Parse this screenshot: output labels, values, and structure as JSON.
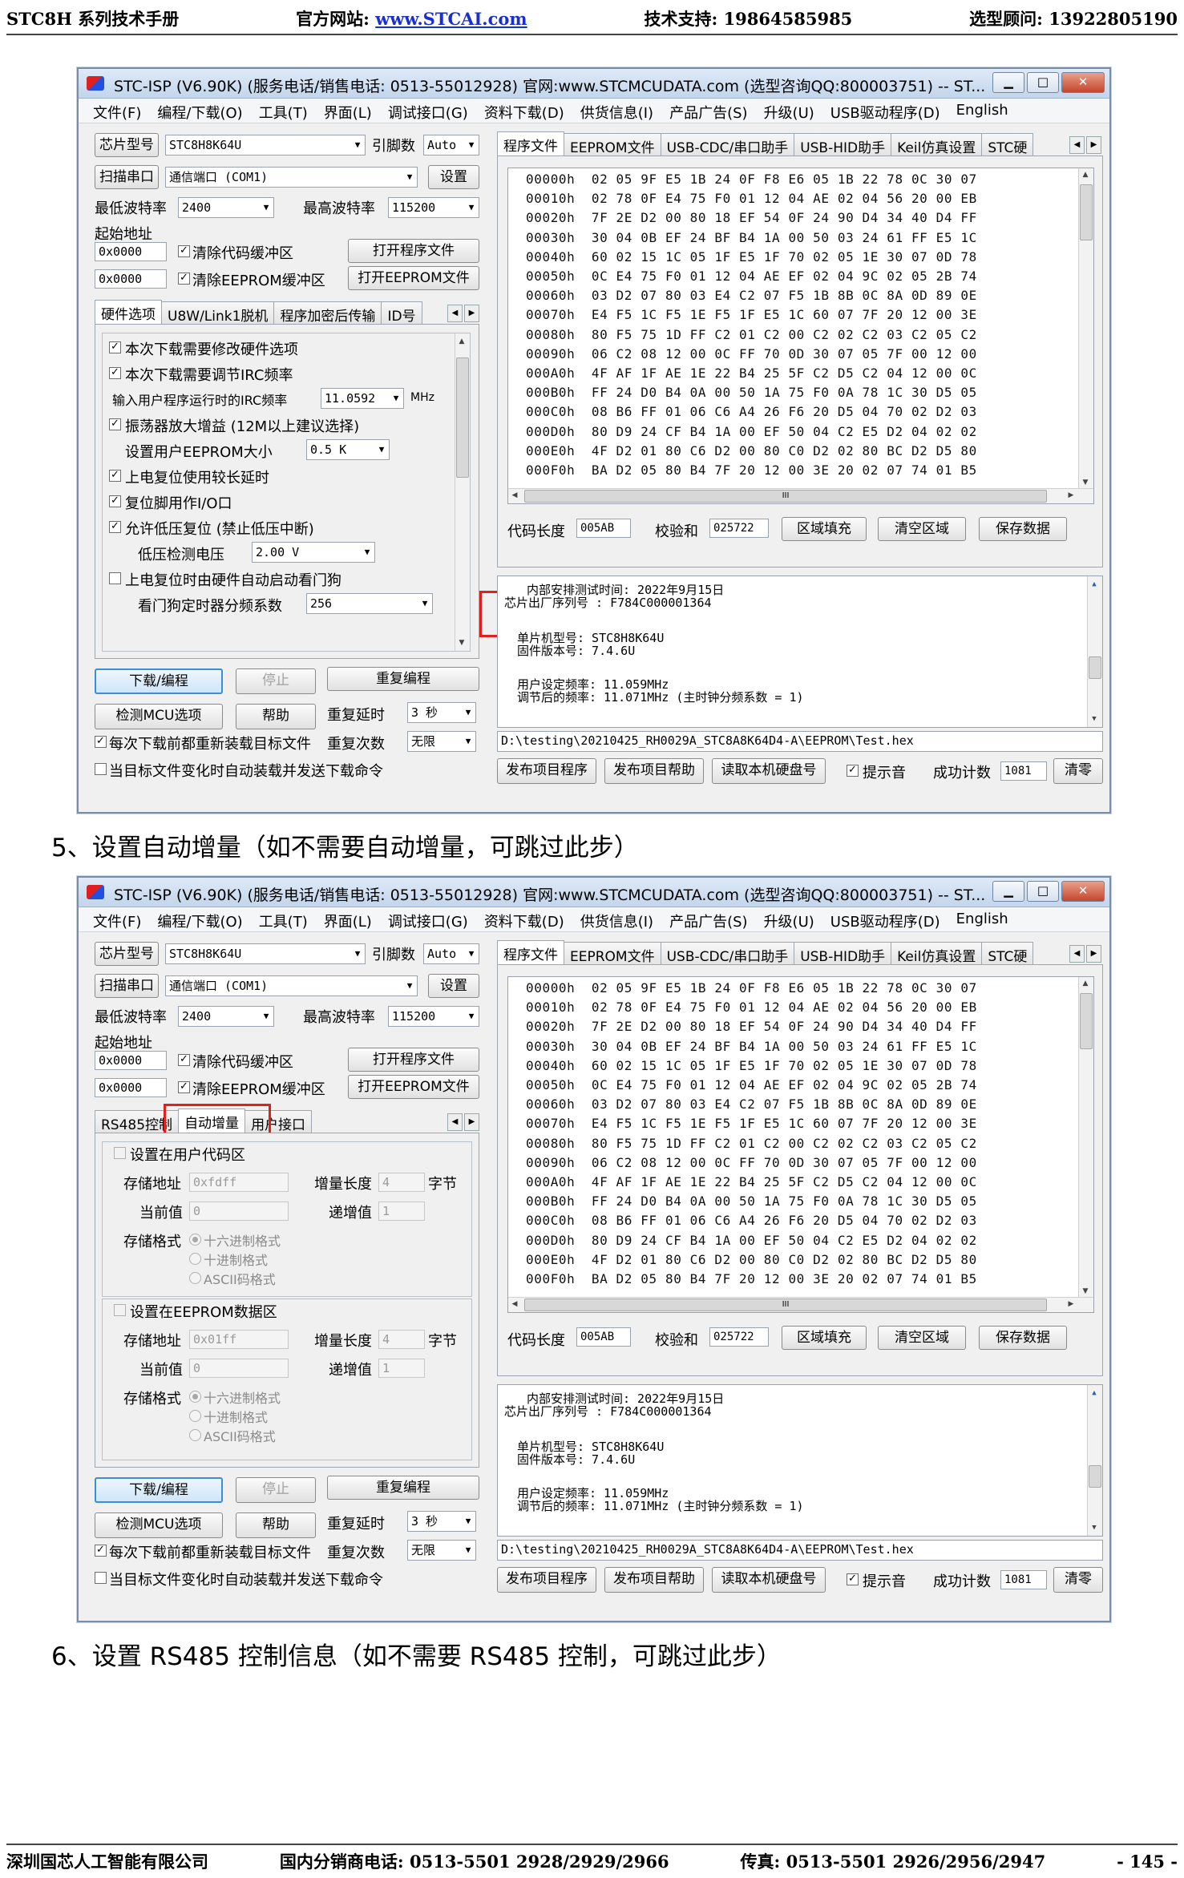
{
  "header": {
    "left": "STC8H 系列技术手册",
    "site_label": "官方网站: ",
    "site_link": "www.STCAI.com",
    "support": "技术支持: 19864585985",
    "sales": "选型顾问: 13922805190"
  },
  "footer": {
    "company": "深圳国芯人工智能有限公司",
    "dist_phone": "国内分销商电话: 0513-5501 2928/2929/2966",
    "fax": "传真: 0513-5501 2926/2956/2947",
    "page": "- 145 -"
  },
  "steps": {
    "step5": "5、设置自动增量（如不需要自动增量，可跳过此步）",
    "step6": "6、设置 RS485 控制信息（如不需要 RS485 控制，可跳过此步）"
  },
  "window": {
    "title": "STC-ISP (V6.90K) (服务电话/销售电话: 0513-55012928) 官网:www.STCMCUDATA.com  (选型咨询QQ:800003751) -- ST...",
    "caption": {
      "min": "▁",
      "max": "□",
      "close": "✕"
    },
    "menu": [
      "文件(F)",
      "编程/下载(O)",
      "工具(T)",
      "界面(L)",
      "调试接口(G)",
      "资料下载(D)",
      "供货信息(I)",
      "产品广告(S)",
      "升级(U)",
      "USB驱动程序(D)",
      "English"
    ],
    "chip_type_btn": "芯片型号",
    "chip_type": "STC8H8K64U",
    "pins_label": "引脚数",
    "pins": "Auto",
    "scan_port_btn": "扫描串口",
    "port": "通信端口  (COM1)",
    "settings_btn": "设置",
    "min_baud_label": "最低波特率",
    "min_baud": "2400",
    "max_baud_label": "最高波特率",
    "max_baud": "115200",
    "start_addr_label": "起始地址",
    "code_addr": "0x0000",
    "clear_code_label": "清除代码缓冲区",
    "open_prog_btn": "打开程序文件",
    "eeprom_addr": "0x0000",
    "clear_eeprom_label": "清除EEPROM缓冲区",
    "open_eeprom_btn": "打开EEPROM文件",
    "right_tabs": [
      "程序文件",
      "EEPROM文件",
      "USB-CDC/串口助手",
      "USB-HID助手",
      "Keil仿真设置",
      "STC硬"
    ],
    "hex_rows": [
      "00000h  02 05 9F E5 1B 24 0F F8 E6 05 1B 22 78 0C 30 07",
      "00010h  02 78 0F E4 75 F0 01 12 04 AE 02 04 56 20 00 EB",
      "00020h  7F 2E D2 00 80 18 EF 54 0F 24 90 D4 34 40 D4 FF",
      "00030h  30 04 0B EF 24 BF B4 1A 00 50 03 24 61 FF E5 1C",
      "00040h  60 02 15 1C 05 1F E5 1F 70 02 05 1E 30 07 0D 78",
      "00050h  0C E4 75 F0 01 12 04 AE EF 02 04 9C 02 05 2B 74",
      "00060h  03 D2 07 80 03 E4 C2 07 F5 1B 8B 0C 8A 0D 89 0E",
      "00070h  E4 F5 1C F5 1E F5 1F E5 1C 60 07 7F 20 12 00 3E",
      "00080h  80 F5 75 1D FF C2 01 C2 00 C2 02 C2 03 C2 05 C2",
      "00090h  06 C2 08 12 00 0C FF 70 0D 30 07 05 7F 00 12 00",
      "000A0h  4F AF 1F AE 1E 22 B4 25 5F C2 D5 C2 04 12 00 0C",
      "000B0h  FF 24 D0 B4 0A 00 50 1A 75 F0 0A 78 1C 30 D5 05",
      "000C0h  08 B6 FF 01 06 C6 A4 26 F6 20 D5 04 70 02 D2 03",
      "000D0h  80 D9 24 CF B4 1A 00 EF 50 04 C2 E5 D2 04 02 02",
      "000E0h  4F D2 01 80 C6 D2 00 80 C0 D2 02 80 BC D2 D5 80",
      "000F0h  BA D2 05 80 B4 7F 20 12 00 3E 20 02 07 74 01 B5"
    ],
    "hscroll_mark": "III",
    "code_len_label": "代码长度",
    "code_len": "005AB",
    "checksum_label": "校验和",
    "checksum": "025722",
    "fill_btn": "区域填充",
    "clear_btn": "清空区域",
    "save_btn": "保存数据",
    "log": {
      "line1": "内部安排测试时间: 2022年9月15日",
      "line2": "芯片出厂序列号 : F784C000001364",
      "line3": "单片机型号: STC8H8K64U",
      "line4": "固件版本号: 7.4.6U",
      "line5": "用户设定频率: 11.059MHz",
      "line6": "调节后的频率: 11.071MHz (主时钟分频系数 = 1)"
    },
    "file_path": "D:\\testing\\20210425_RH0029A_STC8A8K64D4-A\\EEPROM\\Test.hex",
    "download_btn": "下载/编程",
    "stop_btn": "停止",
    "reprogram_btn": "重复编程",
    "detect_btn": "检测MCU选项",
    "help_btn": "帮助",
    "retry_delay_label": "重复延时",
    "retry_delay": "3 秒",
    "retry_count_label": "重复次数",
    "retry_count": "无限",
    "reload_label": "每次下载前都重新装载目标文件",
    "autosend_label": "当目标文件变化时自动装载并发送下载命令",
    "publish_btn": "发布项目程序",
    "publish_help_btn": "发布项目帮助",
    "read_disk_btn": "读取本机硬盘号",
    "sound_label": "提示音",
    "success_label": "成功计数",
    "success_count": "1081",
    "clear_count_btn": "清零"
  },
  "win1": {
    "tabs": [
      "硬件选项",
      "U8W/Link1脱机",
      "程序加密后传输",
      "ID号"
    ],
    "opt_modify": "本次下载需要修改硬件选项",
    "opt_irc": "本次下载需要调节IRC频率",
    "irc_label": "输入用户程序运行时的IRC频率",
    "irc_value": "11.0592",
    "irc_unit": "MHz",
    "opt_amp": "振荡器放大增益 (12M以上建议选择)",
    "eeprom_size_label": "设置用户EEPROM大小",
    "eeprom_size": "0.5 K",
    "opt_por_delay": "上电复位使用较长延时",
    "opt_reset_io": "复位脚用作I/O口",
    "opt_lvr": "允许低压复位 (禁止低压中断)",
    "lvd_label": "低压检测电压",
    "lvd_value": "2.00 V",
    "opt_wdt": "上电复位时由硬件自动启动看门狗",
    "wdt_div_label": "看门狗定时器分频系数",
    "wdt_div": "256"
  },
  "win2": {
    "tabs": [
      "RS485控制",
      "自动增量",
      "用户接口"
    ],
    "code_section": "设置在用户代码区",
    "code_store_addr_label": "存储地址",
    "code_store_addr": "0xfdff",
    "code_inc_len_label": "增量长度",
    "code_inc_len": "4",
    "code_byte_unit": "字节",
    "code_cur_label": "当前值",
    "code_cur": "0",
    "code_step_label": "递增值",
    "code_step": "1",
    "code_fmt_label": "存储格式",
    "fmt_hex": "十六进制格式",
    "fmt_dec": "十进制格式",
    "fmt_ascii": "ASCII码格式",
    "eeprom_section": "设置在EEPROM数据区",
    "ee_store_addr_label": "存储地址",
    "ee_store_addr": "0x01ff",
    "ee_inc_len_label": "增量长度",
    "ee_inc_len": "4",
    "ee_byte_unit": "字节",
    "ee_cur_label": "当前值",
    "ee_cur": "0",
    "ee_step_label": "递增值",
    "ee_step": "1",
    "ee_fmt_label": "存储格式"
  }
}
